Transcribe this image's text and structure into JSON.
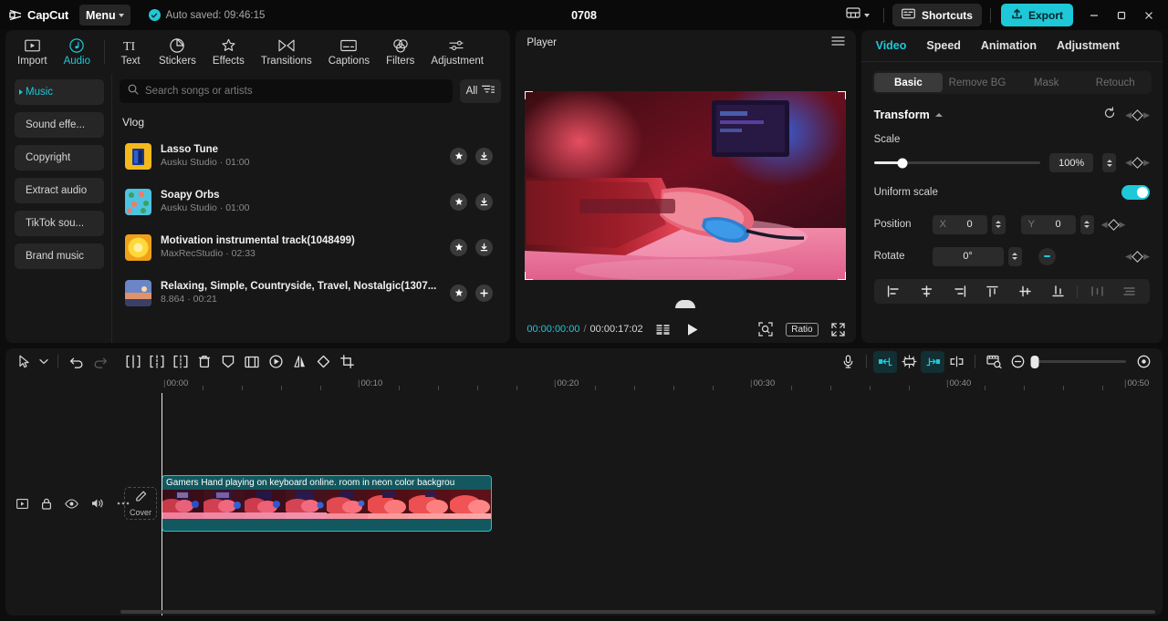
{
  "header": {
    "logo_text": "CapCut",
    "menu_label": "Menu",
    "autosave_text": "Auto saved: 09:46:15",
    "project_title": "0708",
    "shortcuts_label": "Shortcuts",
    "export_label": "Export",
    "accent_color": "#1ec8d8"
  },
  "toolbar": {
    "tabs": [
      {
        "label": "Import",
        "icon": "import-icon",
        "active": false
      },
      {
        "label": "Audio",
        "icon": "audio-note-icon",
        "active": true
      },
      {
        "label": "Text",
        "icon": "text-icon",
        "active": false
      },
      {
        "label": "Stickers",
        "icon": "sticker-icon",
        "active": false
      },
      {
        "label": "Effects",
        "icon": "effects-sparkle-icon",
        "active": false
      },
      {
        "label": "Transitions",
        "icon": "transitions-icon",
        "active": false
      },
      {
        "label": "Captions",
        "icon": "captions-icon",
        "active": false
      },
      {
        "label": "Filters",
        "icon": "filters-icon",
        "active": false
      },
      {
        "label": "Adjustment",
        "icon": "adjustment-sliders-icon",
        "active": false
      }
    ]
  },
  "media": {
    "categories": [
      {
        "label": "Music",
        "active": true
      },
      {
        "label": "Sound effe...",
        "active": false
      },
      {
        "label": "Copyright",
        "active": false
      },
      {
        "label": "Extract audio",
        "active": false
      },
      {
        "label": "TikTok sou...",
        "active": false
      },
      {
        "label": "Brand music",
        "active": false
      }
    ],
    "search": {
      "placeholder": "Search songs or artists",
      "value": ""
    },
    "filter_label": "All",
    "group_title": "Vlog",
    "songs": [
      {
        "name": "Lasso Tune",
        "artist": "Ausku Studio",
        "duration": "01:00",
        "sub": "Ausku Studio · 01:00",
        "action": "download",
        "thumb_a": "#e8a31c",
        "thumb_b": "#2c5fd0"
      },
      {
        "name": "Soapy Orbs",
        "artist": "Ausku Studio",
        "duration": "01:00",
        "sub": "Ausku Studio · 01:00",
        "action": "download",
        "thumb_a": "#4cc3e0",
        "thumb_b": "#3ea05a"
      },
      {
        "name": "Motivation instrumental track(1048499)",
        "artist": "MaxRecStudio",
        "duration": "02:33",
        "sub": "MaxRecStudio · 02:33",
        "action": "download",
        "thumb_a": "#ffd83a",
        "thumb_b": "#f0a018"
      },
      {
        "name": "Relaxing, Simple, Countryside, Travel, Nostalgic(1307...",
        "artist": "8.864",
        "duration": "00:21",
        "sub": "8.864 · 00:21",
        "action": "add",
        "thumb_a": "#6a86c8",
        "thumb_b": "#e0936a"
      }
    ]
  },
  "player": {
    "title": "Player",
    "current_time": "00:00:00:00",
    "separator": "/",
    "total_time": "00:00:17:02",
    "ratio_label": "Ratio"
  },
  "attributes": {
    "tabs": [
      {
        "label": "Video",
        "active": true
      },
      {
        "label": "Speed",
        "active": false
      },
      {
        "label": "Animation",
        "active": false
      },
      {
        "label": "Adjustment",
        "active": false
      }
    ],
    "subtabs": [
      {
        "label": "Basic",
        "active": true
      },
      {
        "label": "Remove BG",
        "active": false
      },
      {
        "label": "Mask",
        "active": false
      },
      {
        "label": "Retouch",
        "active": false
      }
    ],
    "transform": {
      "section_title": "Transform",
      "scale_label": "Scale",
      "scale_value": "100%",
      "scale_percent": 17,
      "uniform_label": "Uniform scale",
      "uniform_on": true,
      "position_label": "Position",
      "position_x_label": "X",
      "position_x_value": "0",
      "position_y_label": "Y",
      "position_y_value": "0",
      "rotate_label": "Rotate",
      "rotate_value": "0°"
    },
    "align_buttons": [
      "align-left-icon",
      "align-center-horizontal-icon",
      "align-right-icon",
      "align-top-icon",
      "align-middle-vertical-icon",
      "align-bottom-icon",
      "distribute-horizontal-icon",
      "distribute-vertical-icon"
    ]
  },
  "timeline": {
    "tools": [
      {
        "name": "select-cursor-icon",
        "state": "normal"
      },
      {
        "name": "cursor-dropdown-icon",
        "state": "normal"
      },
      {
        "name": "undo-icon",
        "state": "normal"
      },
      {
        "name": "redo-icon",
        "state": "dim"
      },
      {
        "name": "split-icon",
        "state": "normal"
      },
      {
        "name": "trim-left-icon",
        "state": "normal"
      },
      {
        "name": "trim-right-icon",
        "state": "normal"
      },
      {
        "name": "delete-icon",
        "state": "normal"
      },
      {
        "name": "freeze-icon",
        "state": "normal"
      },
      {
        "name": "crop-frame-icon",
        "state": "normal"
      },
      {
        "name": "speed-icon",
        "state": "normal"
      },
      {
        "name": "mirror-icon",
        "state": "normal"
      },
      {
        "name": "rotate-icon",
        "state": "normal"
      },
      {
        "name": "crop-icon",
        "state": "normal"
      }
    ],
    "right_tools": [
      {
        "name": "microphone-icon",
        "state": "normal"
      },
      {
        "name": "snap-left-icon",
        "state": "on"
      },
      {
        "name": "auto-snap-icon",
        "state": "normal"
      },
      {
        "name": "snap-right-icon",
        "state": "on"
      },
      {
        "name": "link-icon",
        "state": "normal"
      },
      {
        "name": "preview-scale-icon",
        "state": "normal"
      },
      {
        "name": "zoom-out-icon",
        "state": "normal"
      },
      {
        "name": "zoom-fit-icon",
        "state": "normal"
      }
    ],
    "ruler_labels": [
      "00:00",
      "00:10",
      "00:20",
      "00:30",
      "00:40",
      "00:50"
    ],
    "track_controls": [
      "video-track-icon",
      "lock-icon",
      "eye-icon",
      "speaker-icon",
      "more-options-icon"
    ],
    "cover_label": "Cover",
    "clip": {
      "title": "Gamers Hand playing on keyboard online. room  in neon color backgrou",
      "color": "#12585e",
      "border": "#28c0cc"
    }
  }
}
